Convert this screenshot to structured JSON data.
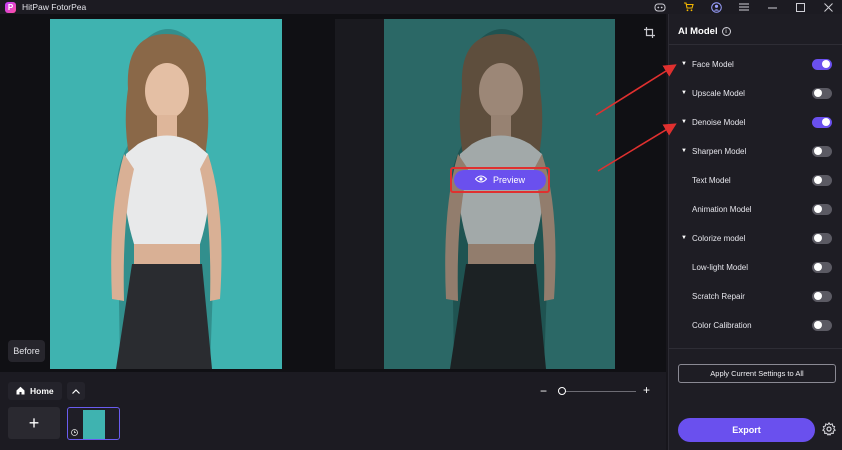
{
  "app": {
    "title": "HitPaw FotorPea",
    "logo_letter": "P"
  },
  "titlebar_icons": [
    "discord-icon",
    "cart-icon",
    "user-icon",
    "menu-icon",
    "minimize-icon",
    "maximize-icon",
    "close-icon"
  ],
  "canvas": {
    "before_label": "Before"
  },
  "preview": {
    "label": "Preview"
  },
  "bottom_bar": {
    "home_label": "Home",
    "add_glyph": "+",
    "zoom_minus": "−",
    "zoom_plus": "+",
    "zoom_level": 0.03
  },
  "sidebar": {
    "title": "AI Model",
    "models": [
      {
        "label": "Face Model",
        "expandable": true,
        "enabled": true
      },
      {
        "label": "Upscale Model",
        "expandable": true,
        "enabled": false
      },
      {
        "label": "Denoise Model",
        "expandable": true,
        "enabled": true
      },
      {
        "label": "Sharpen Model",
        "expandable": true,
        "enabled": false
      },
      {
        "label": "Text Model",
        "expandable": false,
        "enabled": false
      },
      {
        "label": "Animation Model",
        "expandable": false,
        "enabled": false
      },
      {
        "label": "Colorize model",
        "expandable": true,
        "enabled": false
      },
      {
        "label": "Low-light Model",
        "expandable": false,
        "enabled": false
      },
      {
        "label": "Scratch Repair",
        "expandable": false,
        "enabled": false
      },
      {
        "label": "Color Calibration",
        "expandable": false,
        "enabled": false
      }
    ],
    "apply_label": "Apply Current Settings to All",
    "export_label": "Export"
  },
  "colors": {
    "accent": "#6a50ee",
    "annotation": "#e0302f",
    "before_bg": "#3fb3b0",
    "after_bg": "#2b6866"
  }
}
